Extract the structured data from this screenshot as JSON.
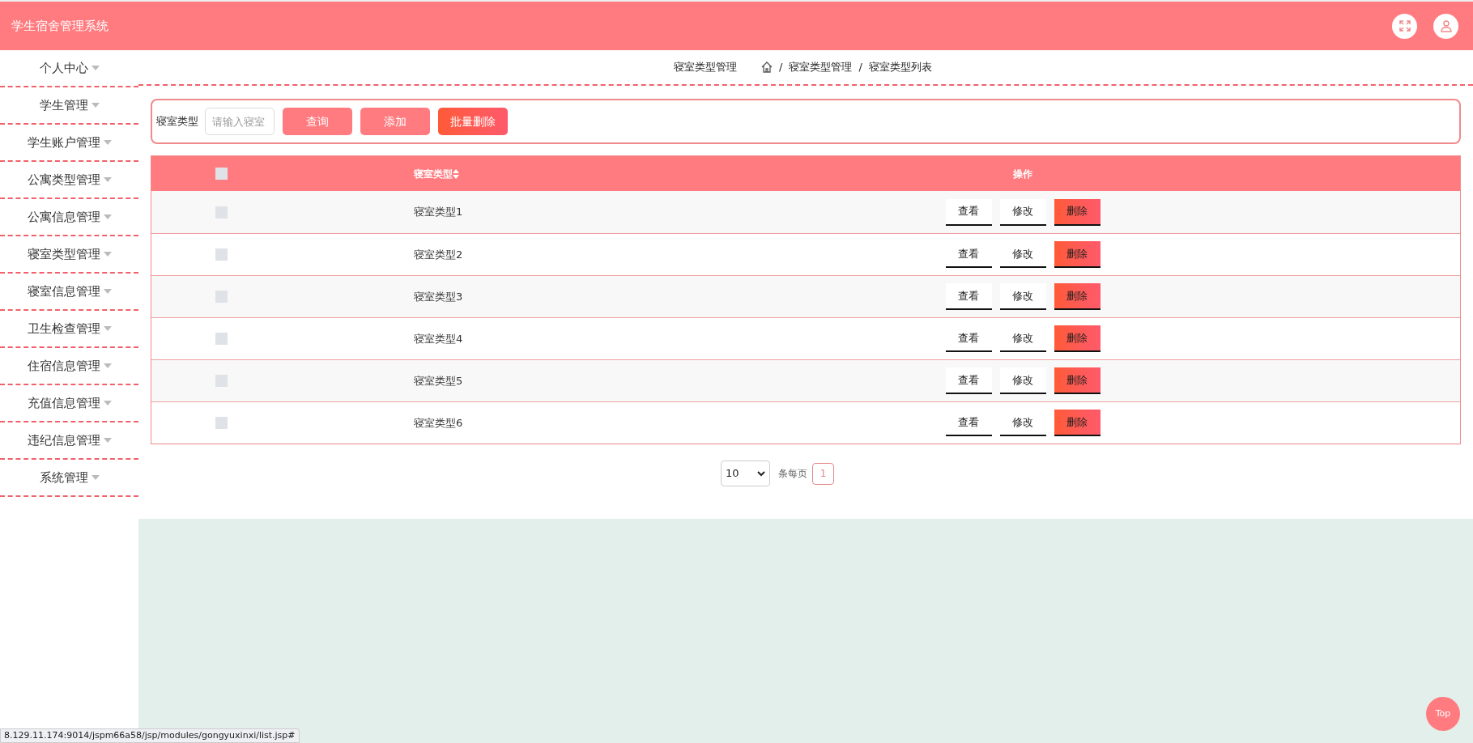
{
  "header": {
    "title": "学生宿舍管理系统"
  },
  "sidebar": {
    "items": [
      {
        "label": "个人中心"
      },
      {
        "label": "学生管理"
      },
      {
        "label": "学生账户管理"
      },
      {
        "label": "公寓类型管理"
      },
      {
        "label": "公寓信息管理"
      },
      {
        "label": "寝室类型管理"
      },
      {
        "label": "寝室信息管理"
      },
      {
        "label": "卫生检查管理"
      },
      {
        "label": "住宿信息管理"
      },
      {
        "label": "充值信息管理"
      },
      {
        "label": "违纪信息管理"
      },
      {
        "label": "系统管理"
      }
    ]
  },
  "breadcrumb": {
    "page_title": "寝室类型管理",
    "separator": "/",
    "trail": [
      "寝室类型管理",
      "寝室类型列表"
    ]
  },
  "search": {
    "label": "寝室类型",
    "placeholder": "请输入寝室",
    "buttons": [
      {
        "label": "查询",
        "kind": "primary"
      },
      {
        "label": "添加",
        "kind": "primary"
      },
      {
        "label": "批量删除",
        "kind": "danger"
      }
    ]
  },
  "table": {
    "select_all_checked": false,
    "columns": [
      {
        "label": "寝室类型",
        "sortable": true
      },
      {
        "label": "操作",
        "sortable": false
      }
    ],
    "rows": [
      {
        "checked": false,
        "name": "寝室类型1",
        "actions": [
          {
            "label": "查看",
            "kind": "plain"
          },
          {
            "label": "修改",
            "kind": "plain"
          },
          {
            "label": "删除",
            "kind": "danger"
          }
        ]
      },
      {
        "checked": false,
        "name": "寝室类型2",
        "actions": [
          {
            "label": "查看",
            "kind": "plain"
          },
          {
            "label": "修改",
            "kind": "plain"
          },
          {
            "label": "删除",
            "kind": "danger"
          }
        ]
      },
      {
        "checked": false,
        "name": "寝室类型3",
        "actions": [
          {
            "label": "查看",
            "kind": "plain"
          },
          {
            "label": "修改",
            "kind": "plain"
          },
          {
            "label": "删除",
            "kind": "danger"
          }
        ]
      },
      {
        "checked": false,
        "name": "寝室类型4",
        "actions": [
          {
            "label": "查看",
            "kind": "plain"
          },
          {
            "label": "修改",
            "kind": "plain"
          },
          {
            "label": "删除",
            "kind": "danger"
          }
        ]
      },
      {
        "checked": false,
        "name": "寝室类型5",
        "actions": [
          {
            "label": "查看",
            "kind": "plain"
          },
          {
            "label": "修改",
            "kind": "plain"
          },
          {
            "label": "删除",
            "kind": "danger"
          }
        ]
      },
      {
        "checked": false,
        "name": "寝室类型6",
        "actions": [
          {
            "label": "查看",
            "kind": "plain"
          },
          {
            "label": "修改",
            "kind": "plain"
          },
          {
            "label": "删除",
            "kind": "danger"
          }
        ]
      }
    ]
  },
  "pagination": {
    "page_size": "10",
    "per_page_label": "条每页",
    "pages": [
      {
        "label": "1",
        "selected": true
      }
    ]
  },
  "back_to_top": "Top",
  "status_bar": "8.129.11.174:9014/jspm66a58/jsp/modules/gongyuxinxi/list.jsp#"
}
